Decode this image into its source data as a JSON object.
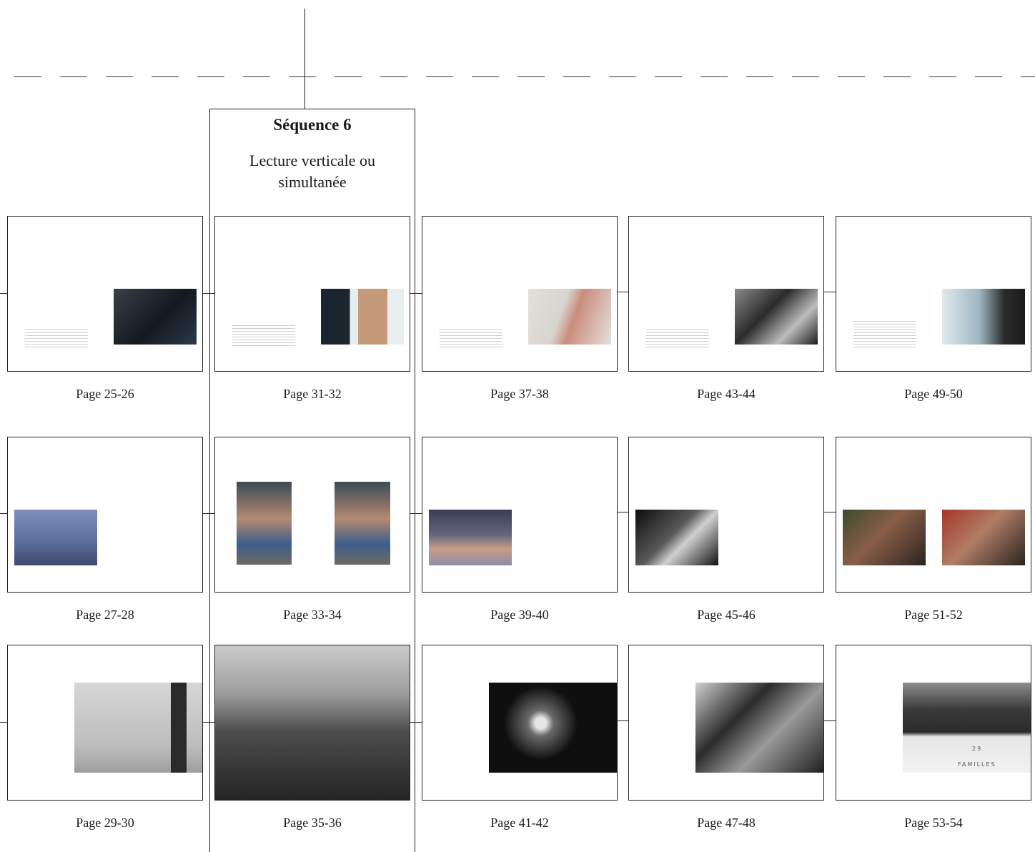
{
  "sequence": {
    "title": "Séquence 6",
    "subtitle_line1": "Lecture verticale ou",
    "subtitle_line2": "simultanée"
  },
  "pages": {
    "p25": "Page 25-26",
    "p27": "Page 27-28",
    "p29": "Page 29-30",
    "p31": "Page 31-32",
    "p33": "Page 33-34",
    "p35": "Page 35-36",
    "p37": "Page 37-38",
    "p39": "Page 39-40",
    "p41": "Page 41-42",
    "p43": "Page 43-44",
    "p45": "Page 45-46",
    "p47": "Page 47-48",
    "p49": "Page 49-50",
    "p51": "Page 51-52",
    "p53": "Page 53-54"
  },
  "photo_inscriptions": {
    "number": "29",
    "word": "FAMILLES"
  }
}
